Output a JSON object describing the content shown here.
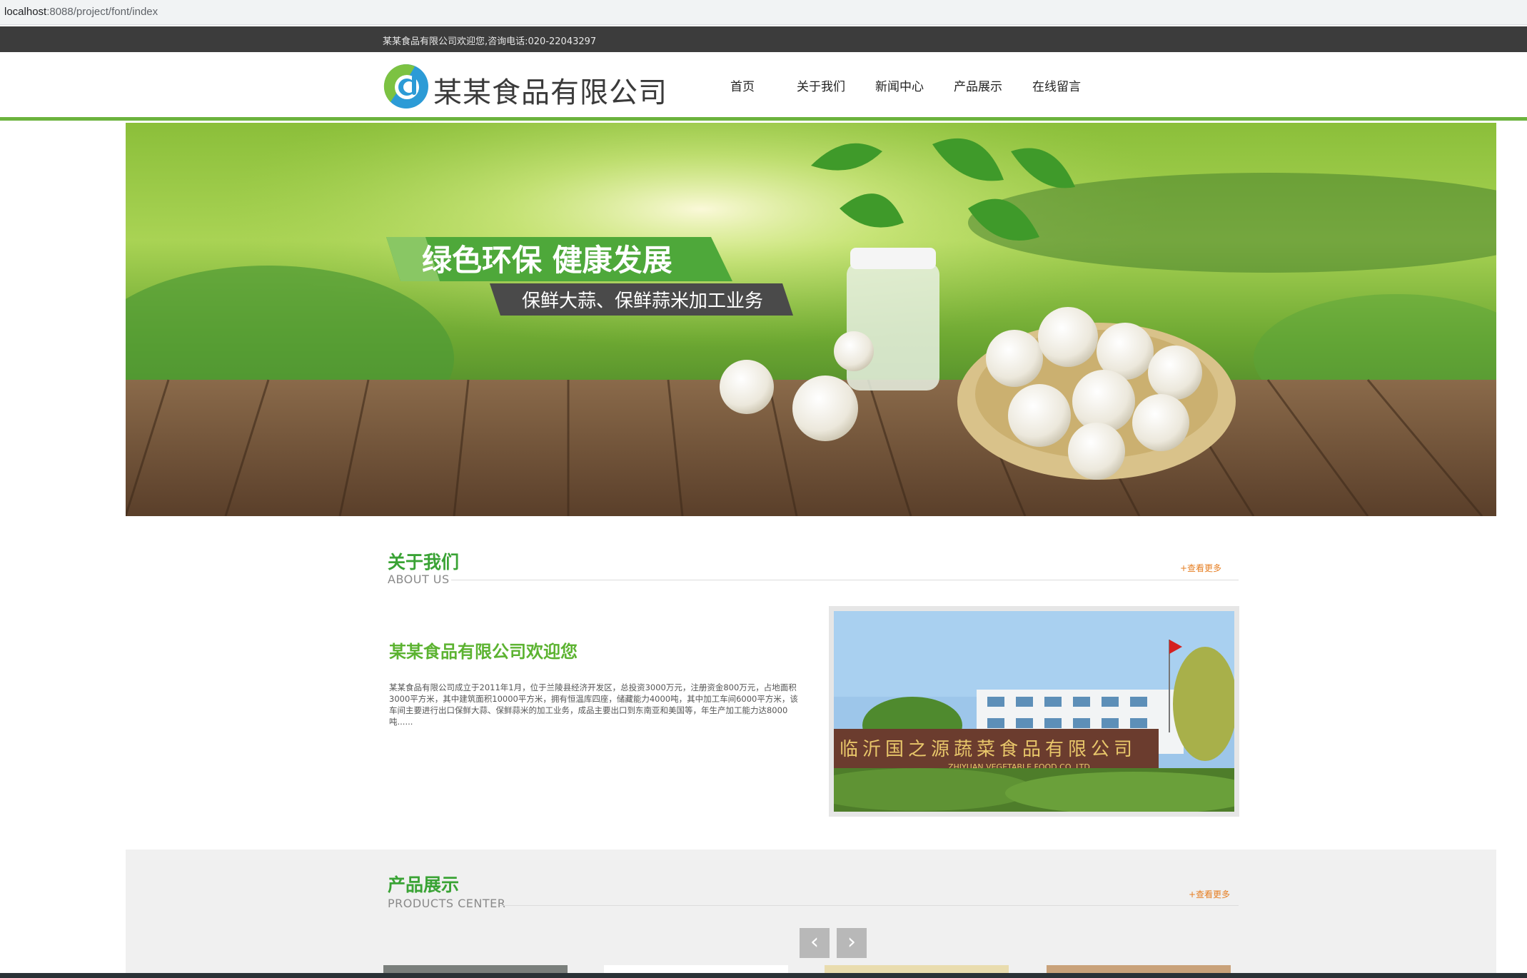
{
  "browser": {
    "url_host": "localhost",
    "url_path": ":8088/project/font/index"
  },
  "topbar": {
    "greeting": "某某食品有限公司欢迎您,咨询电话:020-22043297"
  },
  "header": {
    "company_name": "某某食品有限公司",
    "nav": [
      "首页",
      "关于我们",
      "新闻中心",
      "产品展示",
      "在线留言"
    ]
  },
  "banner": {
    "slogan": "绿色环保  健康发展",
    "subslogan": "保鲜大蒜、保鲜蒜米加工业务"
  },
  "about": {
    "title": "关于我们",
    "subtitle": "ABOUT US",
    "more": "+查看更多",
    "heading": "某某食品有限公司欢迎您",
    "text": "某某食品有限公司成立于2011年1月，位于兰陵县经济开发区，总投资3000万元，注册资金800万元，占地面积3000平方米，其中建筑面积10000平方米，拥有恒温库四座，储藏能力4000吨，其中加工车间6000平方米，该车间主要进行出口保鲜大蒜、保鲜蒜米的加工业务，成品主要出口到东南亚和美国等，年生产加工能力达8000吨......",
    "photo_sign": "临沂国之源蔬菜食品有限公司",
    "photo_sign_en": "ZHIYUAN  VEGETABLE FOOD  CO.,LTD"
  },
  "products": {
    "title": "产品展示",
    "subtitle": "PRODUCTS CENTER",
    "more": "+查看更多",
    "prev_icon": "‹",
    "next_icon": "›"
  },
  "colors": {
    "green": "#3aa335",
    "header_line": "#6cb33e",
    "orange": "#e67e22",
    "topbar": "#3c3c3c"
  }
}
